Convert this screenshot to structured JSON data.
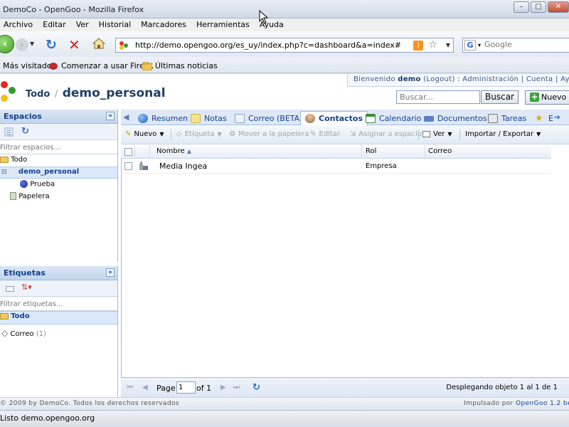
{
  "window": {
    "title": "DemoCo - OpenGoo - Mozilla Firefox",
    "btn_min": "–",
    "btn_max": "□",
    "btn_close": "✕"
  },
  "menu": [
    "Archivo",
    "Editar",
    "Ver",
    "Historial",
    "Marcadores",
    "Herramientas",
    "Ayuda"
  ],
  "nav": {
    "url": "http://demo.opengoo.org/es_uy/index.php?c=dashboard&a=index#",
    "search_placeholder": "Google"
  },
  "bookmarks": [
    "Más visitados",
    "Comenzar a usar Firef...",
    "Últimas noticias"
  ],
  "header": {
    "crumb_root": "Todo",
    "crumb_sep": "/",
    "workspace": "demo_personal",
    "userlinks_prefix": "Bienvenido ",
    "user": "demo",
    "userlinks_rest": " (Logout) : Administración | Cuenta | Ayuda",
    "search_placeholder": "Buscar...",
    "search_button": "Buscar",
    "new_button": "Nuevo"
  },
  "spaces": {
    "title": "Espacios",
    "filter_placeholder": "Filtrar espacios...",
    "items": [
      {
        "label": "Todo"
      },
      {
        "label": "demo_personal"
      },
      {
        "label": "Prueba"
      },
      {
        "label": "Papelera"
      }
    ]
  },
  "tags": {
    "title": "Etiquetas",
    "filter_placeholder": "Filtrar etiquetas...",
    "all": "Todo",
    "items": [
      {
        "label": "Correo",
        "count": "(1)"
      }
    ]
  },
  "tabs": [
    "Resumen",
    "Notas",
    "Correo (BETA)",
    "Contactos",
    "Calendario",
    "Documentos",
    "Tareas",
    "E"
  ],
  "toolbar": {
    "nuevo": "Nuevo",
    "etiqueta": "Etiqueta",
    "mover": "Mover a la papelera",
    "editar": "Editar",
    "asignar": "Asignar a espacio",
    "ver": "Ver",
    "importar": "Importar / Exportar"
  },
  "grid": {
    "columns": [
      "Nombre",
      "Rol",
      "Correo"
    ],
    "rows": [
      {
        "nombre": "Media Ingea",
        "rol": "Empresa",
        "correo": ""
      }
    ]
  },
  "pager": {
    "page_label": "Page",
    "page_value": "1",
    "of_label": "of 1",
    "display": "Desplegando objeto 1 al 1 de 1"
  },
  "footer": {
    "copyright": "© 2009 by DemoCo. Todos los derechos reservados",
    "powered_prefix": "Impulsado por ",
    "powered_link": "OpenGoo 1.2 beta"
  },
  "status": {
    "text": "Listo demo.opengoo.org"
  },
  "colors": {
    "accent": "#15428b",
    "panel_border": "#99bbe8",
    "selected_row": "#d9e8fb"
  }
}
